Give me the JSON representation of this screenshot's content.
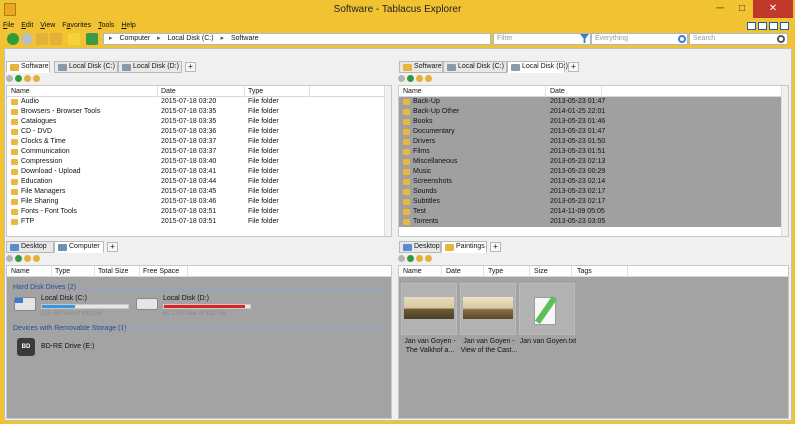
{
  "window": {
    "title": "Software - Tablacus Explorer",
    "minimize": "─",
    "maximize": "□",
    "close": "✕",
    "close_color": "#c0392b"
  },
  "menu": [
    {
      "pre": "",
      "key": "F",
      "post": "ile"
    },
    {
      "pre": "",
      "key": "E",
      "post": "dit"
    },
    {
      "pre": "",
      "key": "V",
      "post": "iew"
    },
    {
      "pre": "F",
      "key": "a",
      "post": "vorites"
    },
    {
      "pre": "",
      "key": "T",
      "post": "ools"
    },
    {
      "pre": "",
      "key": "H",
      "post": "elp"
    }
  ],
  "address": {
    "crumbs": [
      "Computer",
      "Local Disk (C:)",
      "Software"
    ],
    "sep": "▸"
  },
  "filter_placeholder": "Filter",
  "everything_placeholder": "Everything",
  "search_placeholder": "Search",
  "icons": {
    "back": "back-icon",
    "forward": "forward-icon",
    "up": "up-icon",
    "refresh": "refresh-icon",
    "favorite": "star-icon",
    "search": "search-icon"
  },
  "colors": {
    "accent": "#f1c232",
    "selection": "#a0a0a0",
    "disk_c_fill": "#3399dd",
    "disk_d_fill": "#dd2222"
  },
  "top_left": {
    "tabs": [
      "Software",
      "Local Disk (C:)",
      "Local Disk (D:)"
    ],
    "plus": "+",
    "columns": [
      "Name",
      "Date",
      "Type"
    ],
    "rows": [
      {
        "name": "Audio",
        "date": "2015-07-18 03:20",
        "type": "File folder"
      },
      {
        "name": "Browsers - Browser Tools",
        "date": "2015-07-18 03:35",
        "type": "File folder"
      },
      {
        "name": "Catalogues",
        "date": "2015-07-18 03:35",
        "type": "File folder"
      },
      {
        "name": "CD - DVD",
        "date": "2015-07-18 03:36",
        "type": "File folder"
      },
      {
        "name": "Clocks & Time",
        "date": "2015-07-18 03:37",
        "type": "File folder"
      },
      {
        "name": "Communication",
        "date": "2015-07-18 03:37",
        "type": "File folder"
      },
      {
        "name": "Compression",
        "date": "2015-07-18 03:40",
        "type": "File folder"
      },
      {
        "name": "Download - Upload",
        "date": "2015-07-18 03:41",
        "type": "File folder"
      },
      {
        "name": "Education",
        "date": "2015-07-18 03:44",
        "type": "File folder"
      },
      {
        "name": "File Managers",
        "date": "2015-07-18 03:45",
        "type": "File folder"
      },
      {
        "name": "File Sharing",
        "date": "2015-07-18 03:46",
        "type": "File folder"
      },
      {
        "name": "Fonts - Font Tools",
        "date": "2015-07-18 03:51",
        "type": "File folder"
      },
      {
        "name": "FTP",
        "date": "2015-07-18 03:51",
        "type": "File folder"
      }
    ]
  },
  "top_right": {
    "tabs": [
      "Software",
      "Local Disk (C:)",
      "Local Disk (D:)"
    ],
    "plus": "+",
    "columns": [
      "Name",
      "Date"
    ],
    "rows": [
      {
        "name": "Back-Up",
        "date": "2013-05-23 01:47"
      },
      {
        "name": "Back-Up Other",
        "date": "2014-01-25 22:01"
      },
      {
        "name": "Books",
        "date": "2013-05-23 01:46"
      },
      {
        "name": "Documentary",
        "date": "2013-05-23 01:47"
      },
      {
        "name": "Drivers",
        "date": "2013-05-23 01:50"
      },
      {
        "name": "Films",
        "date": "2013-05-23 01:51"
      },
      {
        "name": "Miscellaneous",
        "date": "2013-05-23 02:13"
      },
      {
        "name": "Music",
        "date": "2013-05-23 00:29"
      },
      {
        "name": "Screenshots",
        "date": "2013-05-23 02:14"
      },
      {
        "name": "Sounds",
        "date": "2013-05-23 02:17"
      },
      {
        "name": "Subtitles",
        "date": "2013-05-23 02:17"
      },
      {
        "name": "Test",
        "date": "2014-11-09 05:05"
      },
      {
        "name": "Torrents",
        "date": "2013-05-23 03:05"
      }
    ]
  },
  "bottom_left": {
    "tabs": [
      "Desktop",
      "Computer"
    ],
    "plus": "+",
    "columns": [
      "Name",
      "Type",
      "Total Size",
      "Free Space"
    ],
    "group_hdd": "Hard Disk Drives (2)",
    "group_removable": "Devices with Removable Storage (1)",
    "disks": [
      {
        "name": "Local Disk (C:)",
        "free": "515 GB free of 833 GB",
        "used_fraction": 0.38
      },
      {
        "name": "Local Disk (D:)",
        "free": "60.2 GB free of 931 GB",
        "used_fraction": 0.94
      }
    ],
    "bd_drive": "BD-RE Drive (E:)",
    "bd_label": "BD"
  },
  "bottom_right": {
    "tabs": [
      "Desktop",
      "Paintings"
    ],
    "plus": "+",
    "columns": [
      "Name",
      "Date",
      "Type",
      "Size",
      "Tags"
    ],
    "items": [
      {
        "caption1": "Jan van Goyen -",
        "caption2": "The Valkhof a..."
      },
      {
        "caption1": "Jan van Goyen -",
        "caption2": "View of the Cast..."
      },
      {
        "caption1": "Jan van Goyen.txt",
        "caption2": ""
      }
    ]
  }
}
